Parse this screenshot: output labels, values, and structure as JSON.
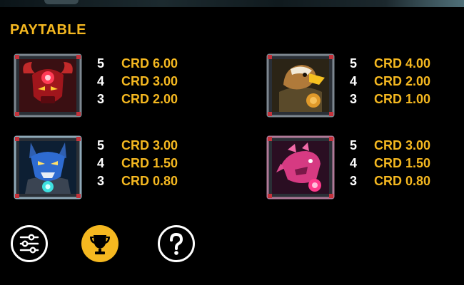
{
  "title": "PAYTABLE",
  "symbols": [
    {
      "icon": "red-bull-robot-symbol",
      "pays": [
        {
          "count": "5",
          "value": "CRD 6.00"
        },
        {
          "count": "4",
          "value": "CRD 3.00"
        },
        {
          "count": "3",
          "value": "CRD 2.00"
        }
      ]
    },
    {
      "icon": "eagle-robot-symbol",
      "pays": [
        {
          "count": "5",
          "value": "CRD 4.00"
        },
        {
          "count": "4",
          "value": "CRD 2.00"
        },
        {
          "count": "3",
          "value": "CRD 1.00"
        }
      ]
    },
    {
      "icon": "blue-wolf-robot-symbol",
      "pays": [
        {
          "count": "5",
          "value": "CRD 3.00"
        },
        {
          "count": "4",
          "value": "CRD 1.50"
        },
        {
          "count": "3",
          "value": "CRD 0.80"
        }
      ]
    },
    {
      "icon": "pink-rhino-robot-symbol",
      "pays": [
        {
          "count": "5",
          "value": "CRD 3.00"
        },
        {
          "count": "4",
          "value": "CRD 1.50"
        },
        {
          "count": "3",
          "value": "CRD 0.80"
        }
      ]
    }
  ],
  "buttons": {
    "settings": {
      "icon": "sliders-icon"
    },
    "paytable": {
      "icon": "trophy-icon",
      "active": true
    },
    "help": {
      "icon": "question-icon"
    }
  },
  "colors": {
    "accent": "#f5b820",
    "text": "#ffffff",
    "background": "#000000"
  }
}
